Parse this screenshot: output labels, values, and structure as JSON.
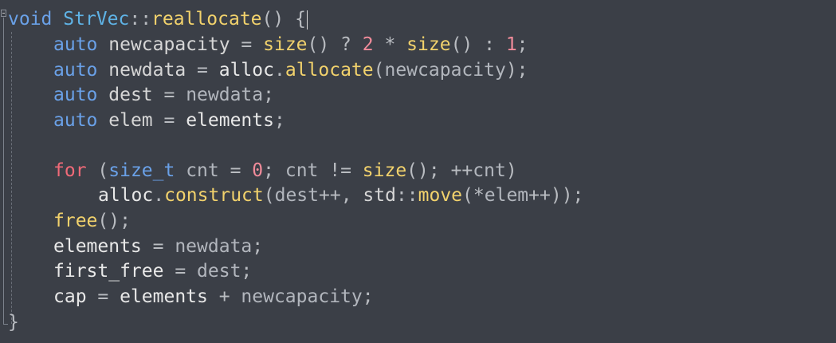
{
  "code": {
    "l1": {
      "void": "void",
      "cls": "StrVec",
      "scope": "::",
      "fn": "reallocate",
      "rest": "() {"
    },
    "l2": {
      "auto": "auto",
      "var": "newcapacity",
      "eq": " = ",
      "size1": "size",
      "p1": "() ? ",
      "two": "2",
      "mul": " * ",
      "size2": "size",
      "p2": "() : ",
      "one": "1",
      "semi": ";"
    },
    "l3": {
      "auto": "auto",
      "var": "newdata",
      "eq": " = ",
      "obj": "alloc",
      "dot": ".",
      "fn": "allocate",
      "open": "(",
      "arg": "newcapacity",
      "close": ");"
    },
    "l4": {
      "auto": "auto",
      "var": "dest",
      "eq": " = ",
      "val": "newdata",
      "semi": ";"
    },
    "l5": {
      "auto": "auto",
      "var": "elem",
      "eq": " = ",
      "val": "elements",
      "semi": ";"
    },
    "l7": {
      "for": "for",
      "open": " (",
      "type": "size_t",
      "var": " cnt",
      "eq": " = ",
      "zero": "0",
      "semi1": "; ",
      "cnt": "cnt",
      "ne": " != ",
      "size": "size",
      "call": "(); ",
      "inc": "++",
      "cnt2": "cnt",
      "close": ")"
    },
    "l8": {
      "obj": "alloc",
      "dot": ".",
      "fn": "construct",
      "open": "(",
      "dest": "dest",
      "inc": "++",
      "comma": ", ",
      "std": "std",
      "scope": "::",
      "move": "move",
      "open2": "(",
      "star": "*",
      "elem": "elem",
      "inc2": "++",
      "close": "));"
    },
    "l9": {
      "fn": "free",
      "rest": "();"
    },
    "l10": {
      "var": "elements",
      "eq": " = ",
      "val": "newdata",
      "semi": ";"
    },
    "l11": {
      "var": "first_free",
      "eq": " = ",
      "val": "dest",
      "semi": ";"
    },
    "l12": {
      "var": "cap",
      "eq": " = ",
      "val": "elements",
      "plus": " + ",
      "val2": "newcapacity",
      "semi": ";"
    },
    "l13": {
      "brace": "}"
    }
  },
  "colors": {
    "background": "#3b3f47",
    "keyword": "#6aa1e8",
    "function": "#f2d26c",
    "control": "#f06a78",
    "number": "#f08b9a"
  },
  "icons": {
    "fold": "fold-collapse-icon"
  }
}
